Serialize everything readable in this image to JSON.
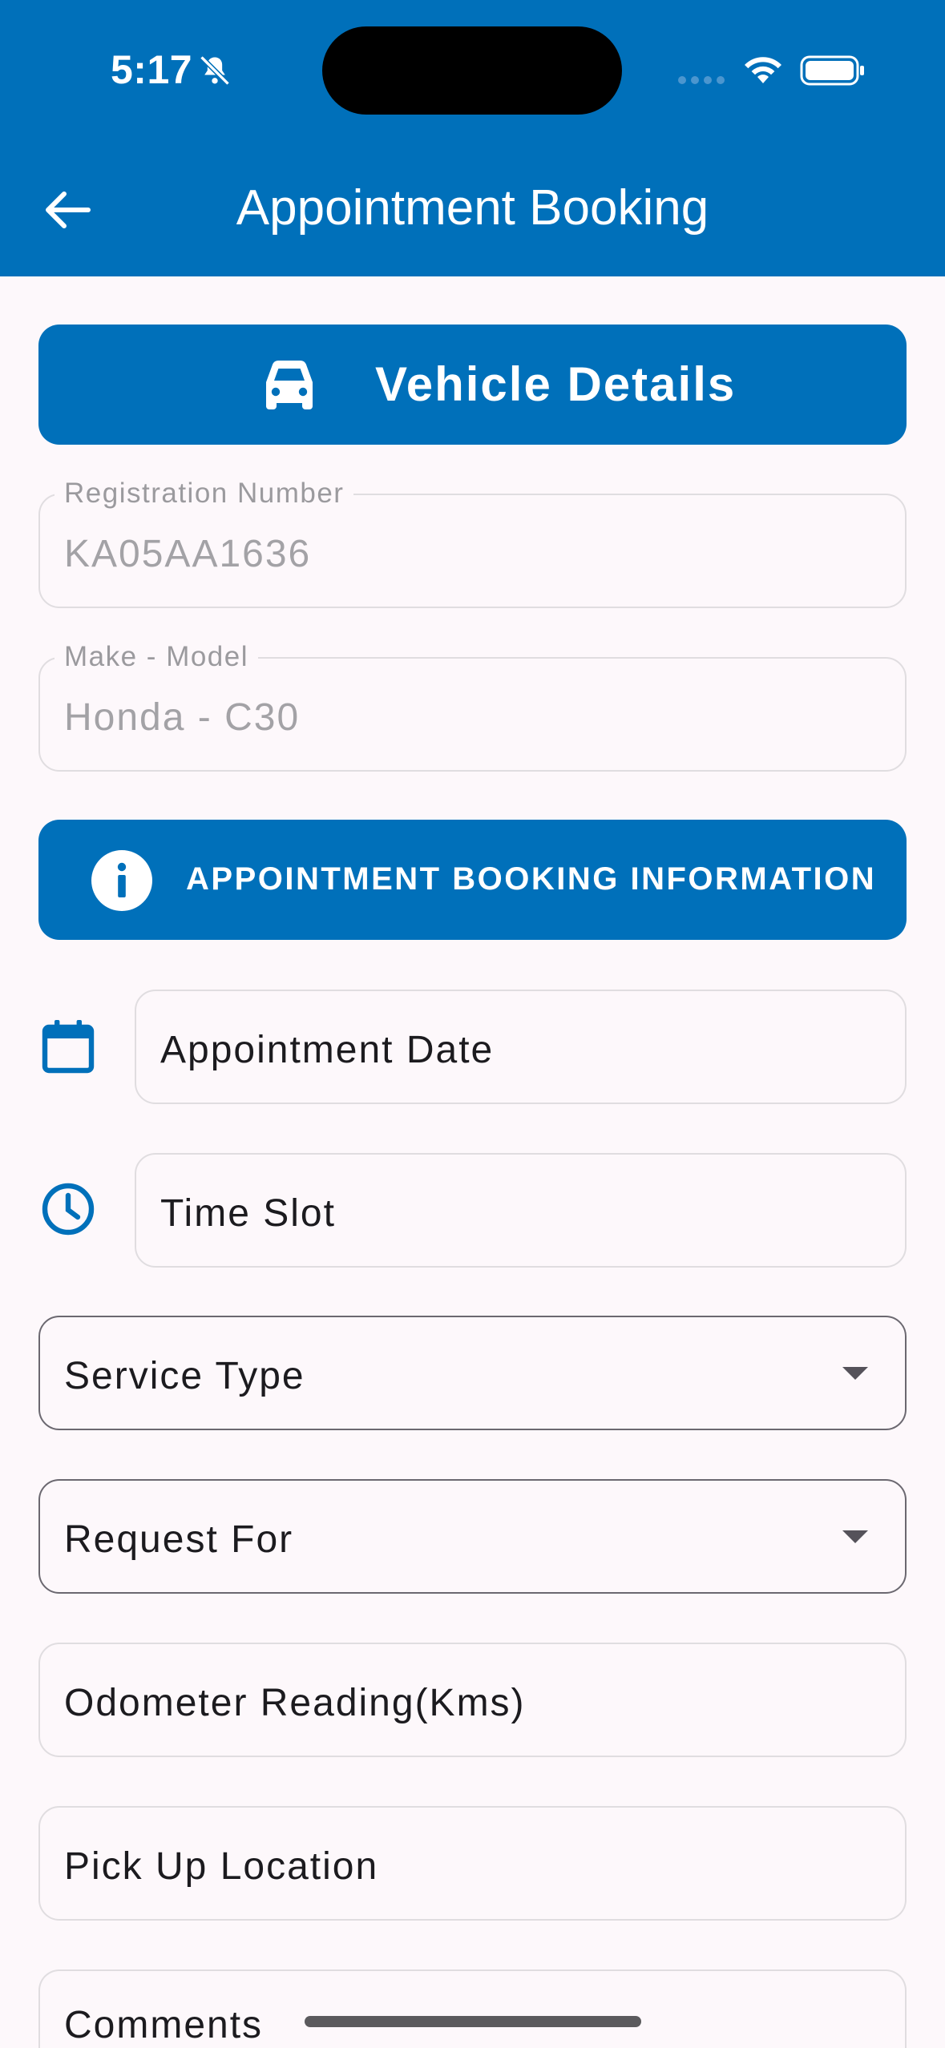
{
  "status_bar": {
    "time": "5:17"
  },
  "header": {
    "title": "Appointment Booking"
  },
  "vehicle_section": {
    "title": "Vehicle Details",
    "registration": {
      "label": "Registration Number",
      "value": "KA05AA1636"
    },
    "make_model": {
      "label": "Make - Model",
      "value": "Honda - C30"
    }
  },
  "booking_section": {
    "title": "APPOINTMENT BOOKING INFORMATION",
    "appointment_date": {
      "placeholder": "Appointment Date"
    },
    "time_slot": {
      "placeholder": "Time Slot"
    },
    "service_type": {
      "placeholder": "Service Type"
    },
    "request_for": {
      "placeholder": "Request For"
    },
    "odometer": {
      "placeholder": "Odometer Reading(Kms)"
    },
    "pickup_location": {
      "placeholder": "Pick Up Location"
    },
    "comments": {
      "placeholder": "Comments"
    }
  },
  "colors": {
    "primary": "#0070ba",
    "background": "#fdf8fb"
  },
  "icons": [
    "bell-slash-icon",
    "signal-icon",
    "wifi-icon",
    "battery-icon",
    "back-arrow-icon",
    "car-icon",
    "info-icon",
    "calendar-icon",
    "clock-icon",
    "dropdown-caret-icon"
  ]
}
